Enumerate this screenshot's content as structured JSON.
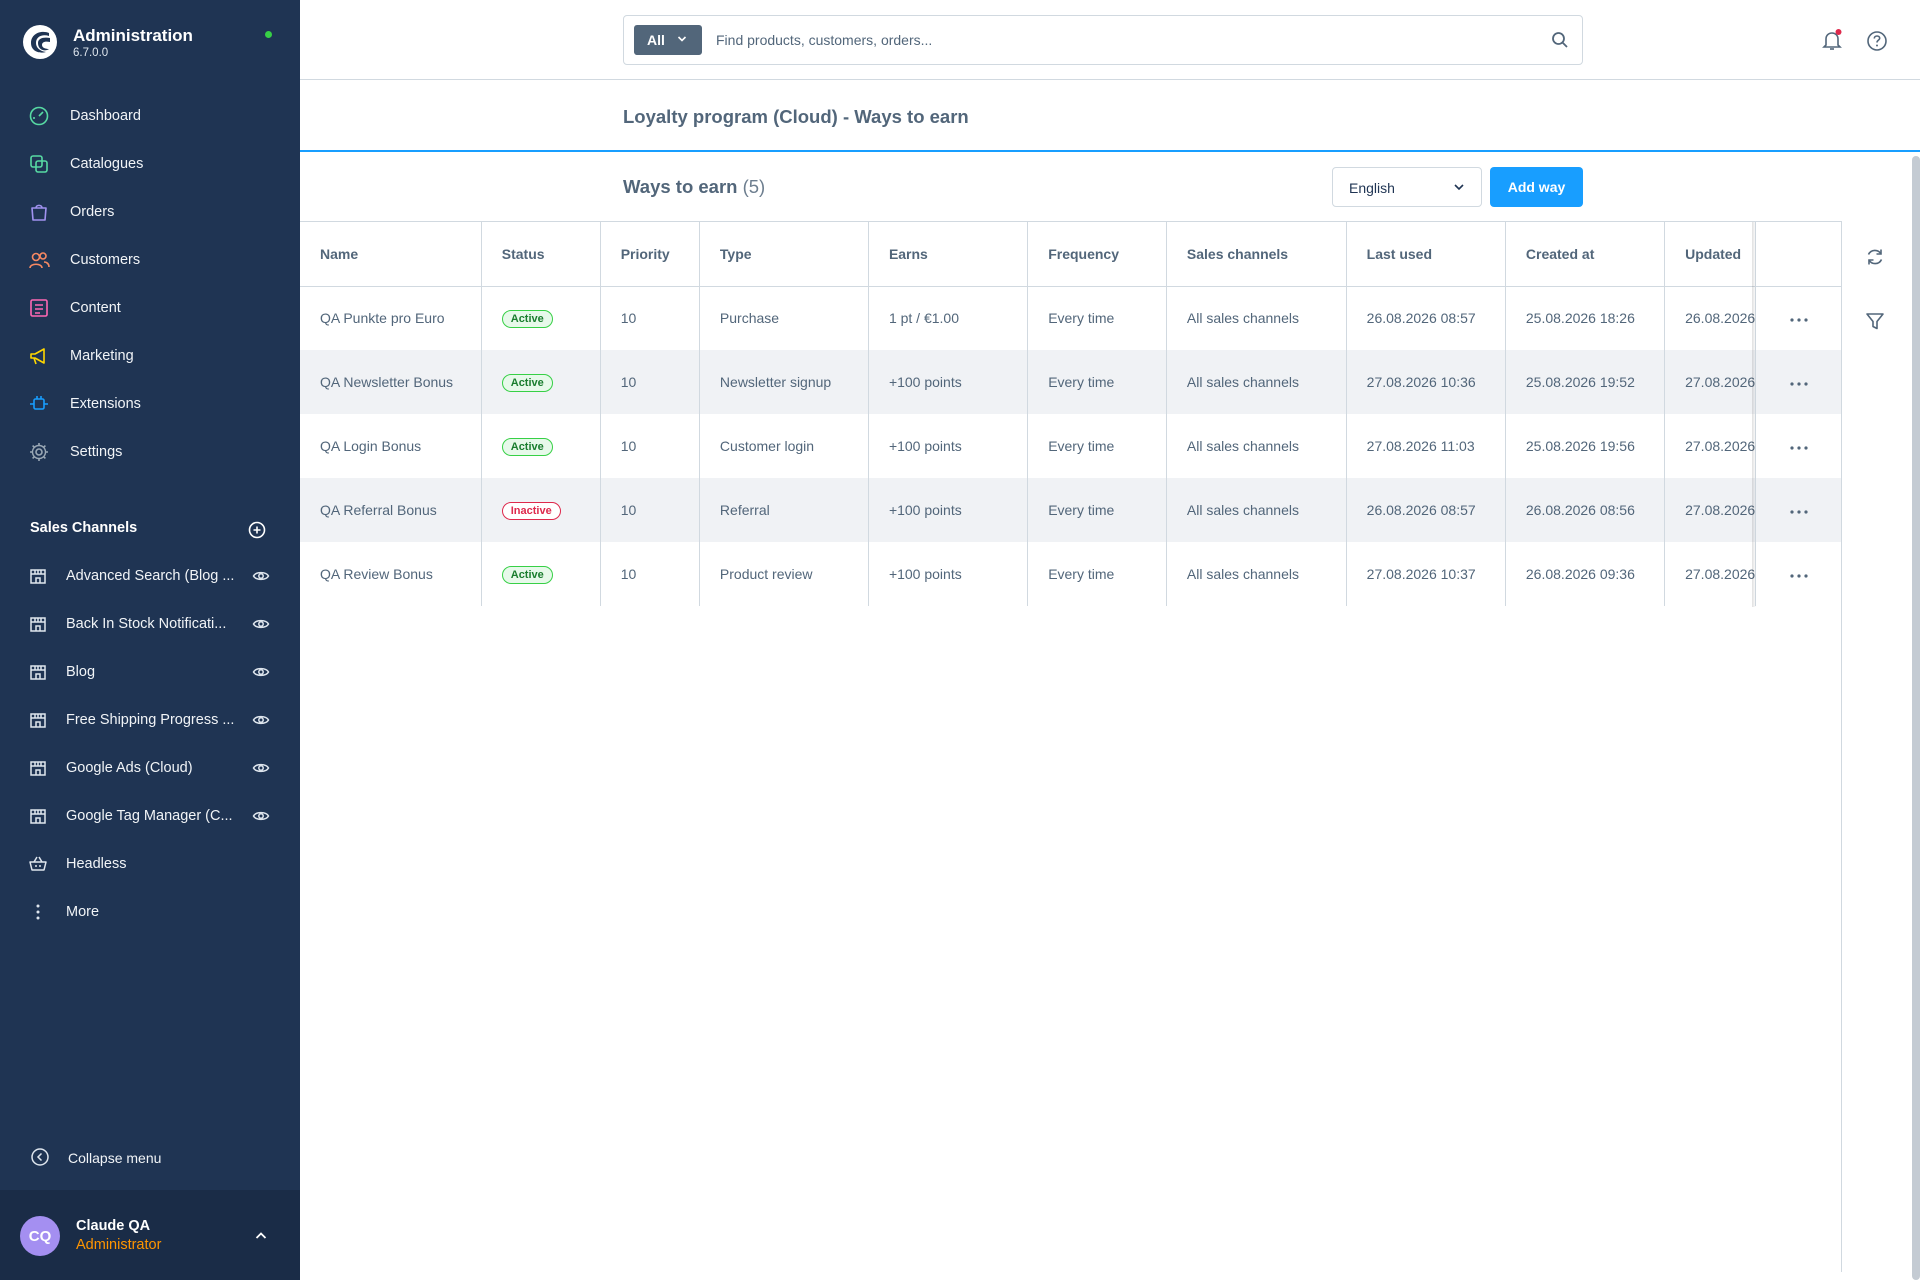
{
  "app": {
    "name": "Administration",
    "version": "6.7.0.0"
  },
  "nav": {
    "items": [
      {
        "label": "Dashboard",
        "icon": "dashboard-icon",
        "color": "#57d9a3"
      },
      {
        "label": "Catalogues",
        "icon": "catalogues-icon",
        "color": "#57d9a3"
      },
      {
        "label": "Orders",
        "icon": "orders-icon",
        "color": "#a092f0"
      },
      {
        "label": "Customers",
        "icon": "customers-icon",
        "color": "#f88962"
      },
      {
        "label": "Content",
        "icon": "content-icon",
        "color": "#ff68b4"
      },
      {
        "label": "Marketing",
        "icon": "marketing-icon",
        "color": "#ffd700"
      },
      {
        "label": "Extensions",
        "icon": "extensions-icon",
        "color": "#189eff"
      },
      {
        "label": "Settings",
        "icon": "settings-icon",
        "color": "#9aa8b5"
      }
    ]
  },
  "sales_channels": {
    "header": "Sales Channels",
    "items": [
      {
        "label": "Advanced Search (Blog ..."
      },
      {
        "label": "Back In Stock Notificati..."
      },
      {
        "label": "Blog"
      },
      {
        "label": "Free Shipping Progress ..."
      },
      {
        "label": "Google Ads (Cloud)"
      },
      {
        "label": "Google Tag Manager (C..."
      },
      {
        "label": "Headless"
      },
      {
        "label": "More"
      }
    ]
  },
  "collapse_label": "Collapse menu",
  "user": {
    "initials": "CQ",
    "name": "Claude QA",
    "role": "Administrator"
  },
  "search": {
    "scope": "All",
    "placeholder": "Find products, customers, orders..."
  },
  "page": {
    "title": "Loyalty program (Cloud) - Ways to earn"
  },
  "card": {
    "title": "Ways to earn",
    "count": "(5)",
    "language": "English",
    "add_label": "Add way"
  },
  "table": {
    "columns": [
      "Name",
      "Status",
      "Priority",
      "Type",
      "Earns",
      "Frequency",
      "Sales channels",
      "Last used",
      "Created at",
      "Updated"
    ],
    "rows": [
      {
        "name": "QA Punkte pro Euro",
        "status": "Active",
        "active": true,
        "priority": "10",
        "type": "Purchase",
        "earns": "1 pt / €1.00",
        "frequency": "Every time",
        "channels": "All sales channels",
        "last_used": "26.08.2026 08:57",
        "created": "25.08.2026 18:26",
        "updated": "26.08.2026"
      },
      {
        "name": "QA Newsletter Bonus",
        "status": "Active",
        "active": true,
        "priority": "10",
        "type": "Newsletter signup",
        "earns": "+100 points",
        "frequency": "Every time",
        "channels": "All sales channels",
        "last_used": "27.08.2026 10:36",
        "created": "25.08.2026 19:52",
        "updated": "27.08.2026"
      },
      {
        "name": "QA Login Bonus",
        "status": "Active",
        "active": true,
        "priority": "10",
        "type": "Customer login",
        "earns": "+100 points",
        "frequency": "Every time",
        "channels": "All sales channels",
        "last_used": "27.08.2026 11:03",
        "created": "25.08.2026 19:56",
        "updated": "27.08.2026"
      },
      {
        "name": "QA Referral Bonus",
        "status": "Inactive",
        "active": false,
        "priority": "10",
        "type": "Referral",
        "earns": "+100 points",
        "frequency": "Every time",
        "channels": "All sales channels",
        "last_used": "26.08.2026 08:57",
        "created": "26.08.2026 08:56",
        "updated": "27.08.2026"
      },
      {
        "name": "QA Review Bonus",
        "status": "Active",
        "active": true,
        "priority": "10",
        "type": "Product review",
        "earns": "+100 points",
        "frequency": "Every time",
        "channels": "All sales channels",
        "last_used": "27.08.2026 10:37",
        "created": "26.08.2026 09:36",
        "updated": "27.08.2026"
      }
    ]
  },
  "colors": {
    "sidebar": "#1f3453",
    "primary": "#189eff",
    "active": "#37d046",
    "inactive": "#de294c",
    "role": "#ff9500"
  }
}
